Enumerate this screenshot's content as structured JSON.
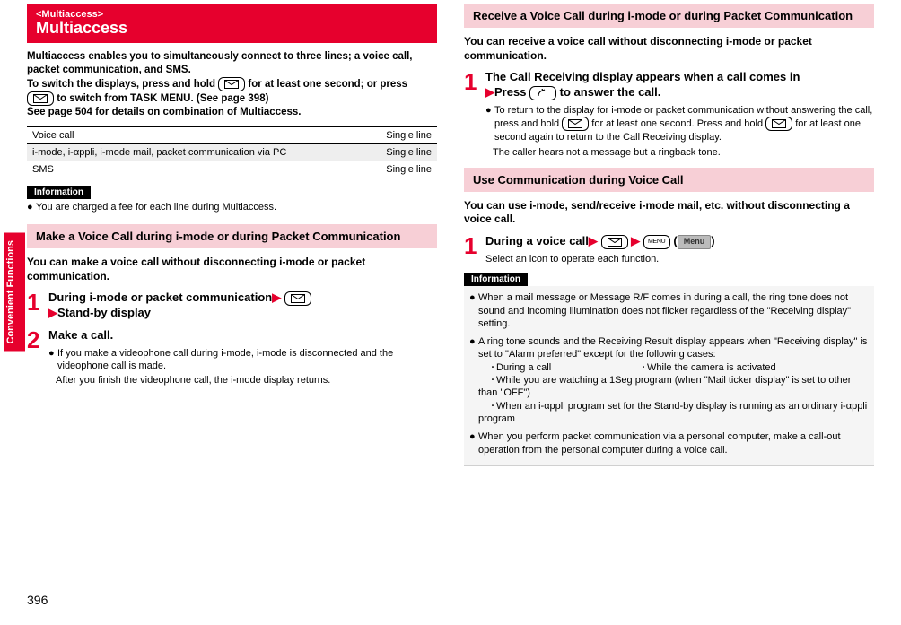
{
  "sidebar": {
    "label": "Convenient Functions"
  },
  "pageNumber": "396",
  "left": {
    "headerTag": "<Multiaccess>",
    "headerTitle": "Multiaccess",
    "intro1": "Multiaccess enables you to simultaneously connect to three lines; a voice call, packet communication, and SMS.",
    "intro2a": "To switch the displays, press and hold ",
    "intro2b": " for at least one second; or press ",
    "intro2c": " to switch from TASK MENU. (See page 398)",
    "intro3": "See page 504 for details on combination of Multiaccess.",
    "table": {
      "r1c1": "Voice call",
      "r1c2": "Single line",
      "r2c1": "i-mode, i-αppli, i-mode mail, packet communication via PC",
      "r2c2": "Single line",
      "r3c1": "SMS",
      "r3c2": "Single line"
    },
    "infoLabel": "Information",
    "infoItem1": "You are charged a fee for each line during Multiaccess.",
    "section1": "Make a Voice Call during i-mode or during Packet Communication",
    "lead1": "You can make a voice call without disconnecting i-mode or packet communication.",
    "step1a": "During i-mode or packet communication",
    "step1b": "Stand-by display",
    "step2": "Make a call.",
    "step2sub1": "If you make a videophone call during i-mode, i-mode is disconnected and the videophone call is made.",
    "step2sub2": "After you finish the videophone call, the i-mode display returns."
  },
  "right": {
    "section2": "Receive a Voice Call during i-mode or during Packet Communication",
    "lead2": "You can receive a voice call without disconnecting i-mode or packet communication.",
    "r_step1a": "The Call Receiving display appears when a call comes in",
    "r_step1b": "Press ",
    "r_step1c": " to answer the call.",
    "r_step1_sub_a": "To return to the display for i-mode or packet communication without answering the call, press and hold ",
    "r_step1_sub_b": " for at least one second. Press and hold ",
    "r_step1_sub_c": " for at least one second again to return to the Call Receiving display.",
    "r_step1_sub2": "The caller hears not a message but a ringback tone.",
    "section3": "Use Communication during Voice Call",
    "lead3": "You can use i-mode, send/receive i-mode mail, etc. without disconnecting a voice call.",
    "r2_step1a": "During a voice call",
    "menuWord": "MENU",
    "menuBtn": "Menu",
    "r2_step1_sub": "Select an icon to operate each function.",
    "infoLabel2": "Information",
    "info_b1": "When a mail message or Message R/F comes in during a call, the ring tone does not sound and incoming illumination does not flicker regardless of the \"Receiving display\" setting.",
    "info_b2_lead": "A ring tone sounds and the Receiving Result display appears when \"Receiving display\" is set to \"Alarm preferred\" except for the following cases:",
    "case1a": "During a call",
    "case1b": "While the camera is activated",
    "case2": "While you are watching a 1Seg program (when \"Mail ticker display\" is set to other than \"OFF\")",
    "case3": "When an i-αppli program set for the Stand-by display is running as an ordinary i-αppli program",
    "info_b3": "When you perform packet communication via a personal computer, make a call-out operation from the personal computer during a voice call."
  }
}
